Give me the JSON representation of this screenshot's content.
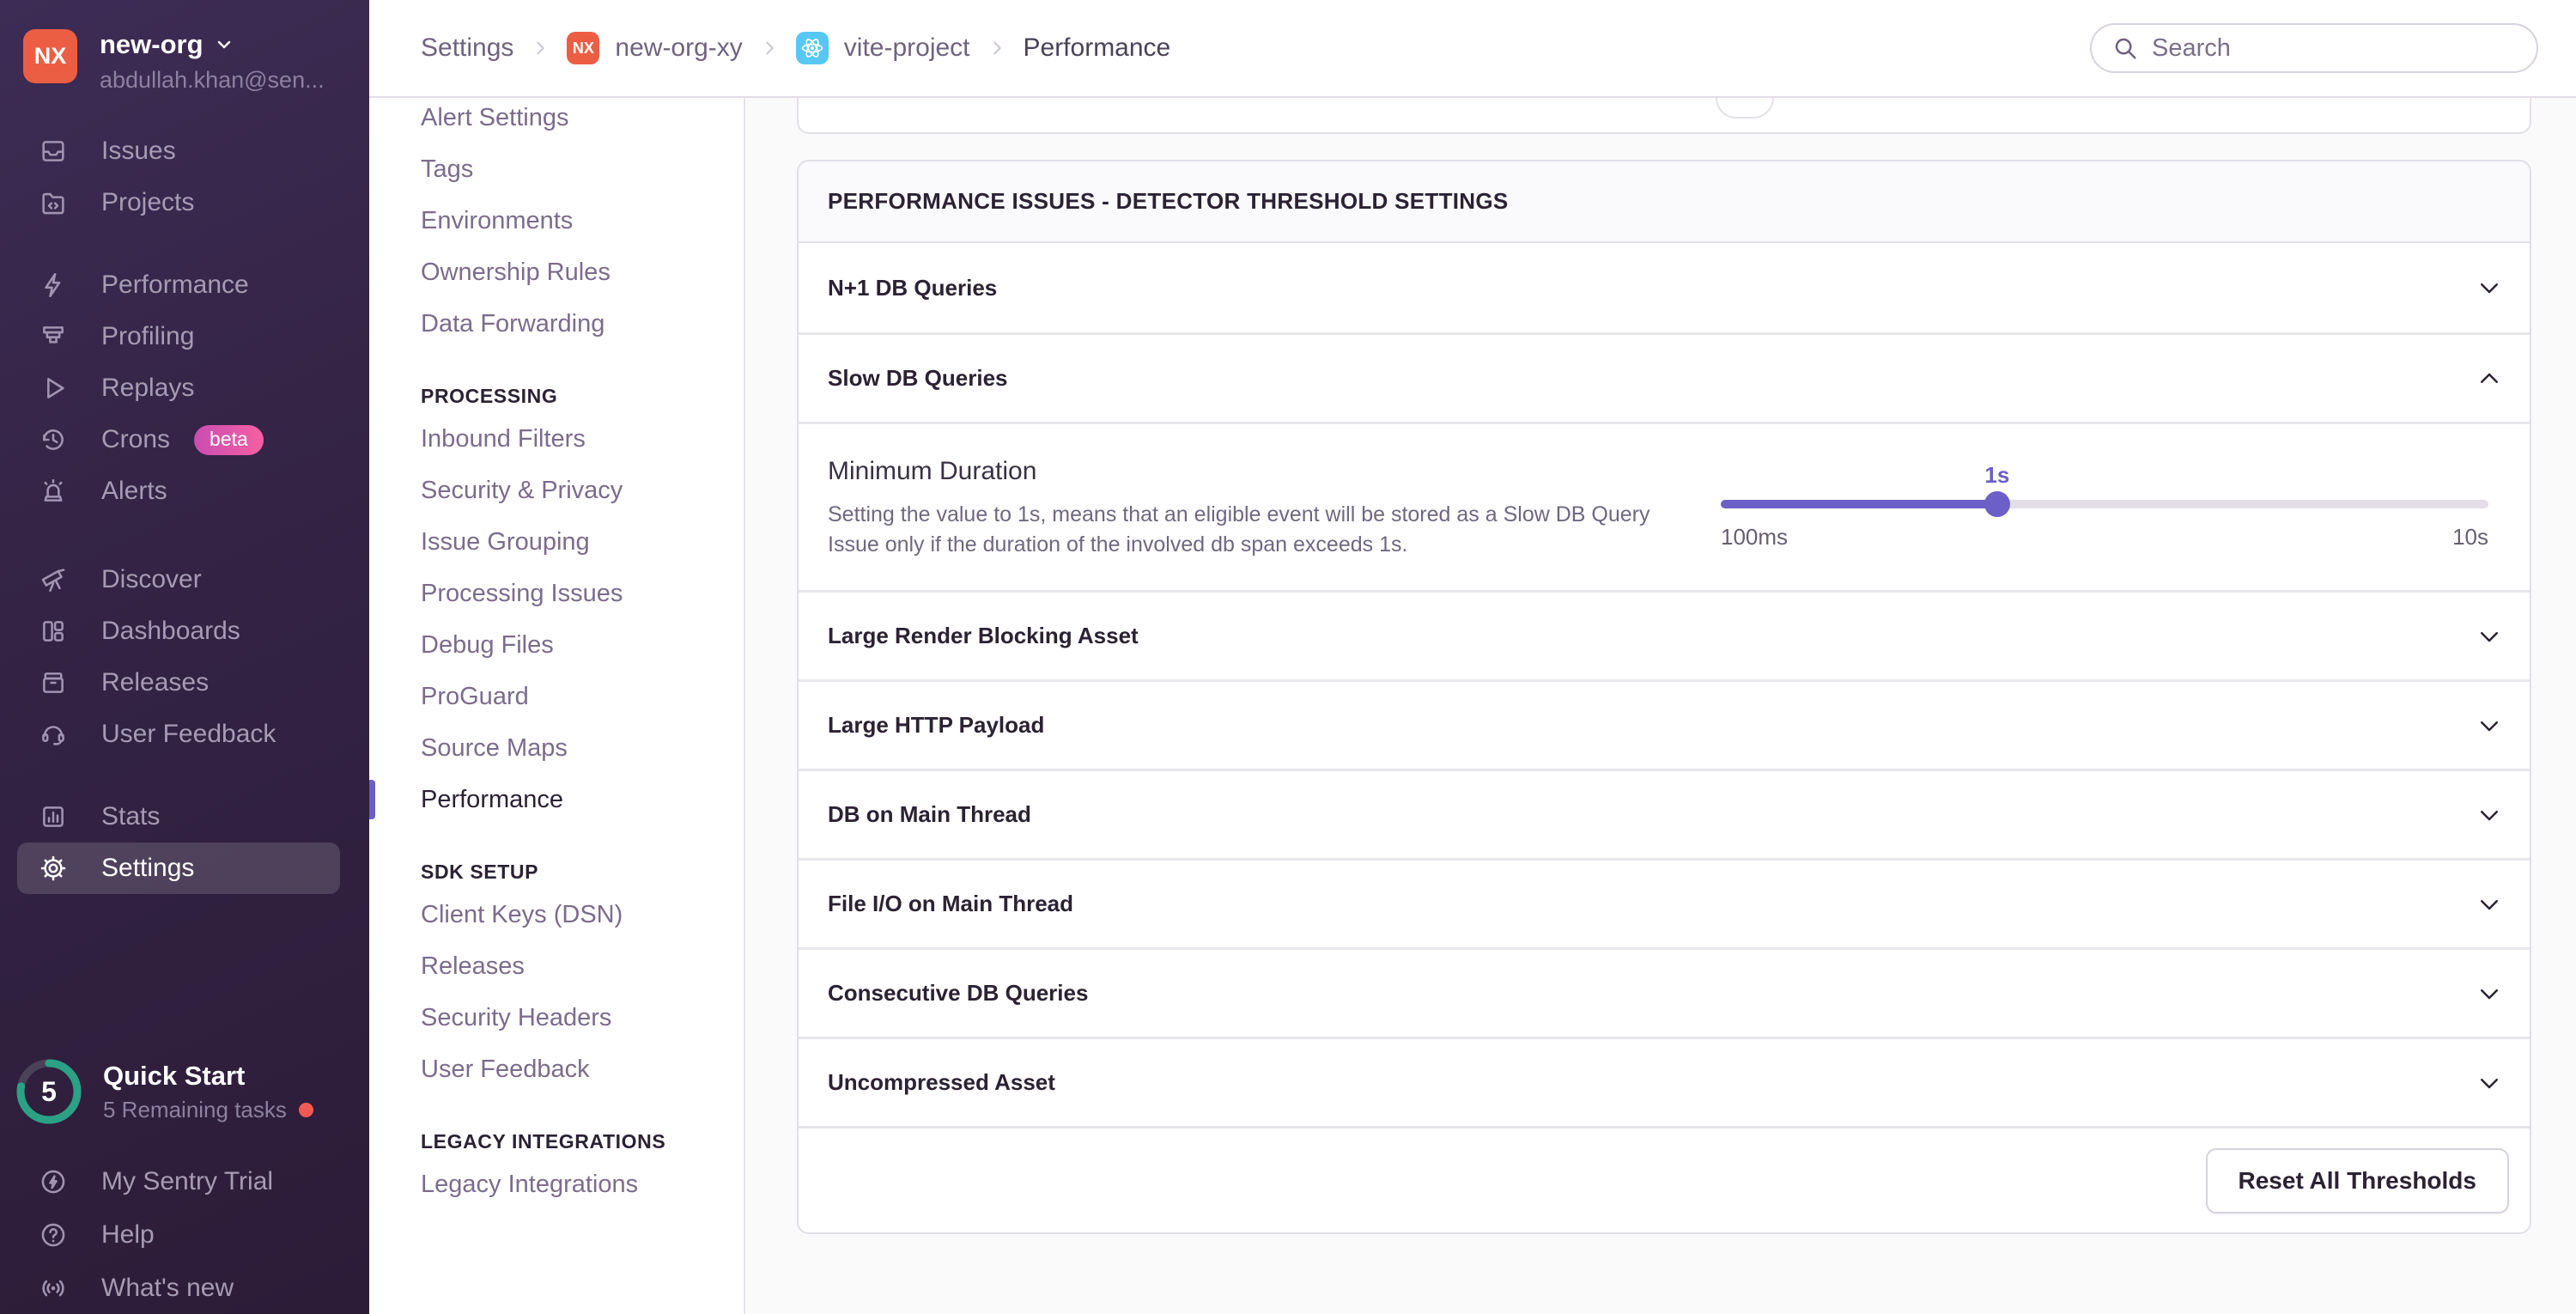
{
  "colors": {
    "accent_purple": "#6C5FC7",
    "brand_orange": "#EC5E44",
    "react_blue": "#57C8F5",
    "teal": "#2BA185",
    "beta_gradient_start": "#C94DB2",
    "beta_gradient_end": "#F660A2",
    "alert_dot": "#F55953"
  },
  "sidebar": {
    "org": {
      "avatar_initials": "NX",
      "name": "new-org",
      "email": "abdullah.khan@sen..."
    },
    "sections": [
      {
        "items": [
          {
            "icon": "issues",
            "label": "Issues"
          },
          {
            "icon": "projects",
            "label": "Projects"
          }
        ]
      },
      {
        "items": [
          {
            "icon": "performance",
            "label": "Performance"
          },
          {
            "icon": "profiling",
            "label": "Profiling"
          },
          {
            "icon": "replays",
            "label": "Replays"
          },
          {
            "icon": "crons",
            "label": "Crons",
            "badge": "beta"
          },
          {
            "icon": "alerts",
            "label": "Alerts"
          }
        ]
      },
      {
        "items": [
          {
            "icon": "discover",
            "label": "Discover"
          },
          {
            "icon": "dashboards",
            "label": "Dashboards"
          },
          {
            "icon": "releases",
            "label": "Releases"
          },
          {
            "icon": "user-feedback",
            "label": "User Feedback"
          }
        ]
      },
      {
        "items": [
          {
            "icon": "stats",
            "label": "Stats"
          },
          {
            "icon": "settings",
            "label": "Settings",
            "active": true
          }
        ]
      }
    ],
    "quick_start": {
      "title": "Quick Start",
      "subtitle": "5 Remaining tasks",
      "count": "5",
      "progress_percent": 78
    },
    "footer_items": [
      {
        "icon": "trial",
        "label": "My Sentry Trial"
      },
      {
        "icon": "help",
        "label": "Help"
      },
      {
        "icon": "whats-new",
        "label": "What's new"
      }
    ]
  },
  "topbar": {
    "breadcrumbs": [
      {
        "label": "Settings"
      },
      {
        "label": "new-org-xy",
        "badge": "NX"
      },
      {
        "label": "vite-project",
        "badge": "react"
      },
      {
        "label": "Performance",
        "current": true
      }
    ],
    "search_placeholder": "Search"
  },
  "settings_nav": {
    "sections": [
      {
        "items": [
          "Alert Settings",
          "Tags",
          "Environments",
          "Ownership Rules",
          "Data Forwarding"
        ]
      },
      {
        "header": "PROCESSING",
        "items": [
          "Inbound Filters",
          "Security & Privacy",
          "Issue Grouping",
          "Processing Issues",
          "Debug Files",
          "ProGuard",
          "Source Maps",
          "Performance"
        ],
        "active": "Performance"
      },
      {
        "header": "SDK SETUP",
        "items": [
          "Client Keys (DSN)",
          "Releases",
          "Security Headers",
          "User Feedback"
        ]
      },
      {
        "header": "LEGACY INTEGRATIONS",
        "items": [
          "Legacy Integrations"
        ]
      }
    ]
  },
  "panel": {
    "title": "PERFORMANCE ISSUES - DETECTOR THRESHOLD SETTINGS",
    "rows": [
      {
        "label": "N+1 DB Queries",
        "expanded": false
      },
      {
        "label": "Slow DB Queries",
        "expanded": true
      },
      {
        "label": "Large Render Blocking Asset",
        "expanded": false
      },
      {
        "label": "Large HTTP Payload",
        "expanded": false
      },
      {
        "label": "DB on Main Thread",
        "expanded": false
      },
      {
        "label": "File I/O on Main Thread",
        "expanded": false
      },
      {
        "label": "Consecutive DB Queries",
        "expanded": false
      },
      {
        "label": "Uncompressed Asset",
        "expanded": false
      }
    ],
    "slow_db_detail": {
      "setting_label": "Minimum Duration",
      "setting_description": "Setting the value to 1s, means that an eligible event will be stored as a Slow DB Query Issue only if the duration of the involved db span exceeds 1s.",
      "slider": {
        "value_label": "1s",
        "min_label": "100ms",
        "max_label": "10s",
        "percent": 36
      }
    },
    "footer_button": "Reset All Thresholds"
  }
}
